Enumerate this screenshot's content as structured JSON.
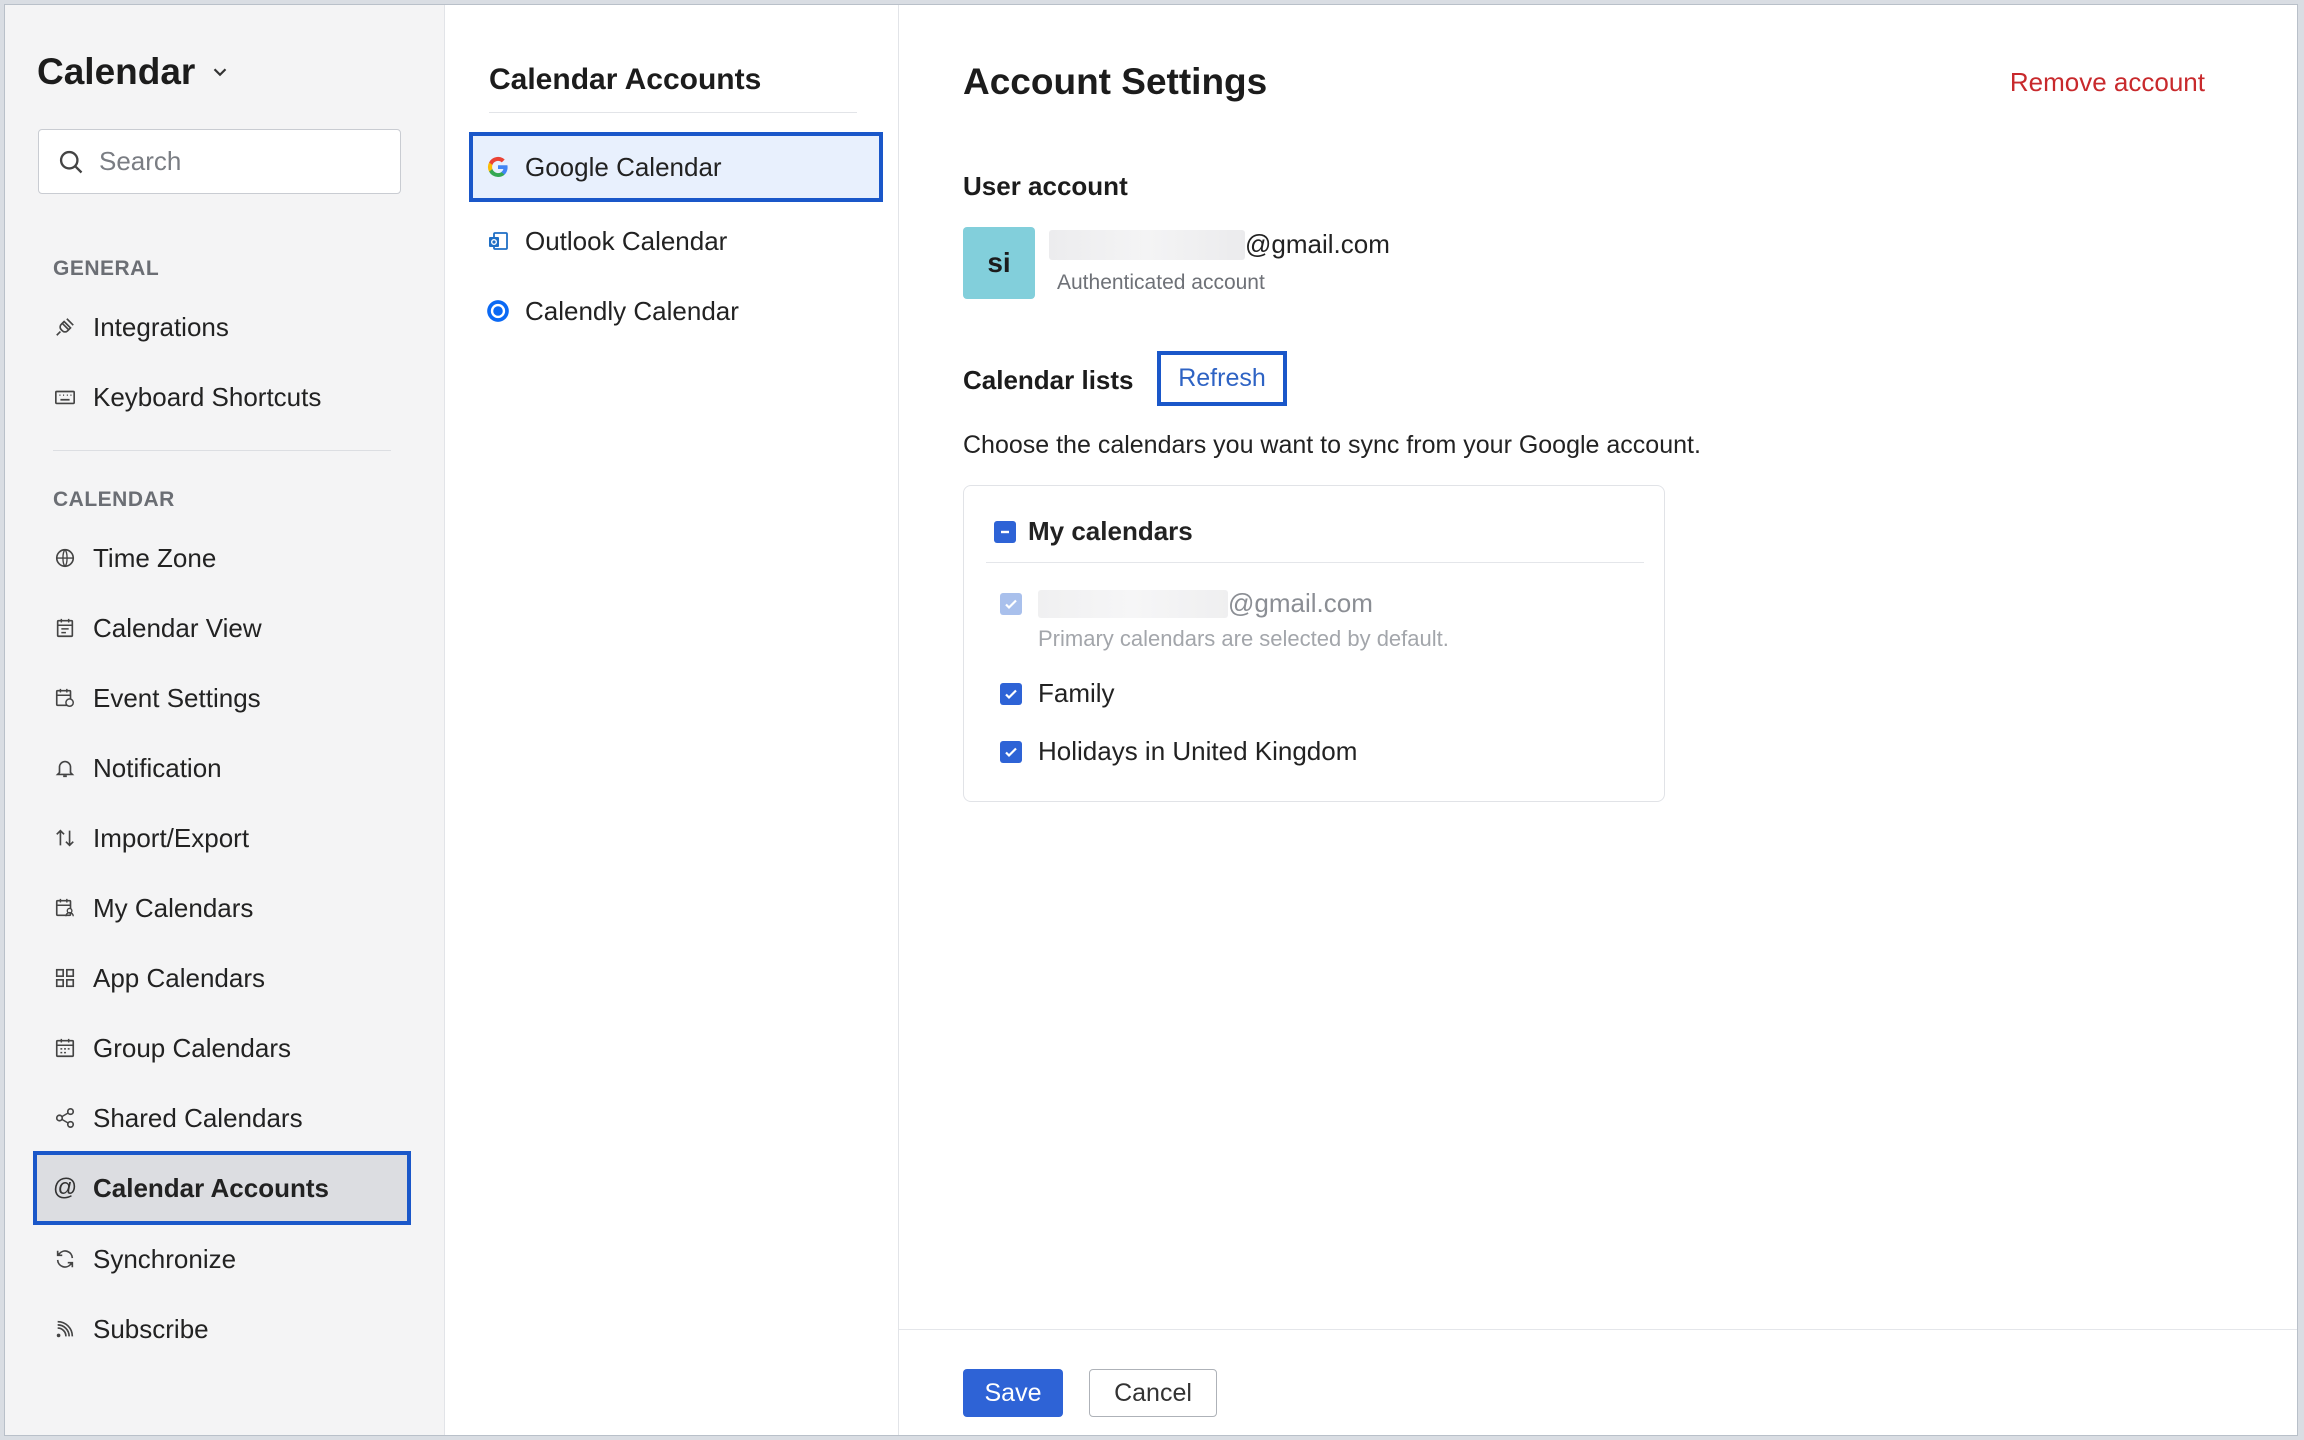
{
  "app": {
    "title": "Calendar"
  },
  "search": {
    "placeholder": "Search"
  },
  "sidebar": {
    "general_label": "GENERAL",
    "calendar_label": "CALENDAR",
    "general_items": [
      {
        "label": "Integrations",
        "icon": "plug-icon"
      },
      {
        "label": "Keyboard Shortcuts",
        "icon": "keyboard-icon"
      }
    ],
    "calendar_items": [
      {
        "label": "Time Zone",
        "icon": "globe-icon"
      },
      {
        "label": "Calendar View",
        "icon": "calendar-view-icon"
      },
      {
        "label": "Event Settings",
        "icon": "event-settings-icon"
      },
      {
        "label": "Notification",
        "icon": "bell-icon"
      },
      {
        "label": "Import/Export",
        "icon": "import-export-icon"
      },
      {
        "label": "My Calendars",
        "icon": "my-calendars-icon"
      },
      {
        "label": "App Calendars",
        "icon": "app-grid-icon"
      },
      {
        "label": "Group Calendars",
        "icon": "group-calendar-icon"
      },
      {
        "label": "Shared Calendars",
        "icon": "share-icon"
      },
      {
        "label": "Calendar Accounts",
        "icon": "at-icon",
        "active": true
      },
      {
        "label": "Synchronize",
        "icon": "sync-icon"
      },
      {
        "label": "Subscribe",
        "icon": "rss-icon"
      }
    ]
  },
  "accounts": {
    "title": "Calendar Accounts",
    "items": [
      {
        "label": "Google Calendar",
        "icon": "google-icon",
        "active": true
      },
      {
        "label": "Outlook Calendar",
        "icon": "outlook-icon"
      },
      {
        "label": "Calendly Calendar",
        "icon": "calendly-icon"
      }
    ]
  },
  "settings": {
    "title": "Account Settings",
    "remove_label": "Remove account",
    "user_account_label": "User account",
    "avatar_initials": "si",
    "email_suffix": "@gmail.com",
    "auth_text": "Authenticated account",
    "calendar_lists_label": "Calendar lists",
    "refresh_label": "Refresh",
    "description": "Choose the calendars you want to sync from your Google account.",
    "group_label": "My calendars",
    "primary_email_suffix": "@gmail.com",
    "primary_note": "Primary calendars are selected by default.",
    "calendars": [
      {
        "label": "Family",
        "checked": true
      },
      {
        "label": "Holidays in United Kingdom",
        "checked": true
      }
    ],
    "save_label": "Save",
    "cancel_label": "Cancel"
  },
  "colors": {
    "accent": "#2e63d6",
    "highlight_border": "#1a57c9",
    "danger": "#c8292c",
    "avatar_bg": "#82cfdb"
  }
}
